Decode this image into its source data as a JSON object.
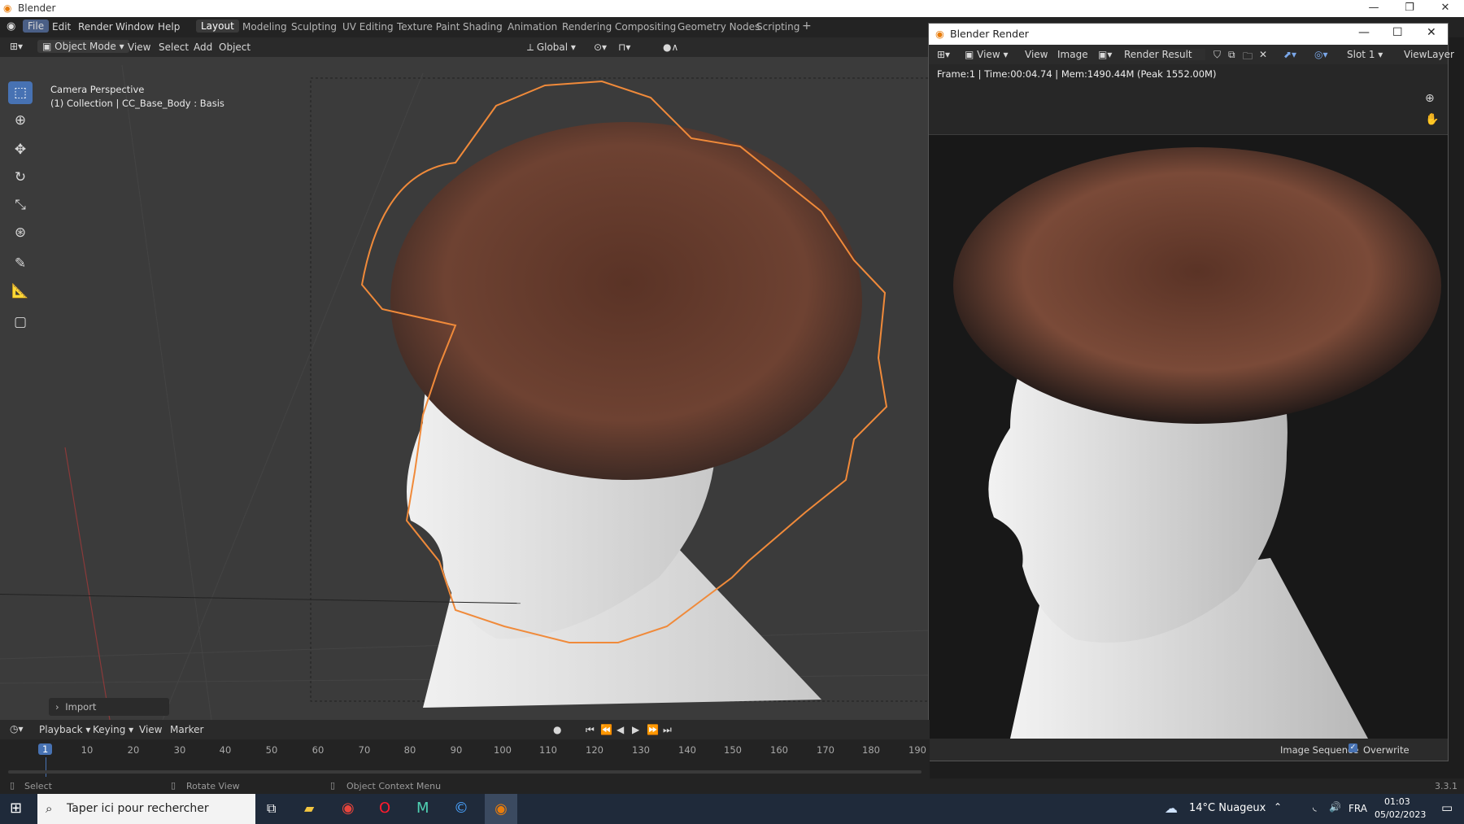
{
  "os": {
    "title": "Blender",
    "minimize": "—",
    "maximize": "❐",
    "close": "✕"
  },
  "menu": [
    "File",
    "Edit",
    "Render",
    "Window",
    "Help"
  ],
  "workspaces": [
    "Layout",
    "Modeling",
    "Sculpting",
    "UV Editing",
    "Texture Paint",
    "Shading",
    "Animation",
    "Rendering",
    "Compositing",
    "Geometry Nodes",
    "Scripting"
  ],
  "add_workspace": "+",
  "viewport_header": {
    "mode": "Object Mode",
    "view": "View",
    "select": "Select",
    "add": "Add",
    "object": "Object",
    "orientation": "Global"
  },
  "overlay": {
    "line1": "Camera Perspective",
    "line2": "(1) Collection | CC_Base_Body : Basis"
  },
  "import_panel": "Import",
  "render_window": {
    "title": "Blender Render",
    "header": {
      "view1": "View",
      "view2": "View",
      "image": "Image",
      "result": "Render Result",
      "slot": "Slot 1",
      "layer": "ViewLayer"
    },
    "info": "Frame:1 | Time:00:04.74 | Mem:1490.44M (Peak 1552.00M)",
    "bottom": {
      "sequence": "Image Sequence",
      "overwrite": "Overwrite"
    }
  },
  "timeline": {
    "playback": "Playback",
    "keying": "Keying",
    "view": "View",
    "marker": "Marker",
    "current_frame": "1",
    "ticks": [
      "10",
      "20",
      "30",
      "40",
      "50",
      "60",
      "70",
      "80",
      "90",
      "100",
      "110",
      "120",
      "130",
      "140",
      "150",
      "160",
      "170",
      "180",
      "190"
    ]
  },
  "statusbar": {
    "select": "Select",
    "rotate": "Rotate View",
    "context": "Object Context Menu",
    "version": "3.3.1"
  },
  "taskbar": {
    "search": "Taper ici pour rechercher",
    "weather": "14°C  Nuageux",
    "lang": "FRA",
    "time": "01:03",
    "date": "05/02/2023"
  },
  "colors": {
    "accent": "#4772b3",
    "selection_outline": "#f08a3a",
    "hair": "#6b3c2c",
    "skin": "#dcdcdc"
  }
}
